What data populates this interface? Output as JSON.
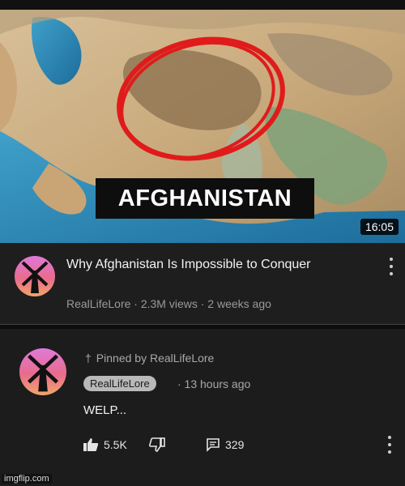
{
  "thumbnail": {
    "title_card_text": "AFGHANISTAN",
    "duration": "16:05",
    "circle_color": "#e01b1b"
  },
  "video": {
    "title": "Why Afghanistan Is Impossible to Conquer",
    "meta": "RealLifeLore · 2.3M views · 2 weeks ago",
    "menu_icon": "more-vert-icon"
  },
  "comment": {
    "pinned_text": "Pinned by RealLifeLore",
    "author": "RealLifeLore",
    "time": "· 13 hours ago",
    "text": "WELP...",
    "likes": "5.5K",
    "replies": "329",
    "icons": [
      "pin-icon",
      "thumbs-up-icon",
      "thumbs-down-icon",
      "reply-icon",
      "more-vert-icon"
    ]
  },
  "watermark": "imgflip.com"
}
